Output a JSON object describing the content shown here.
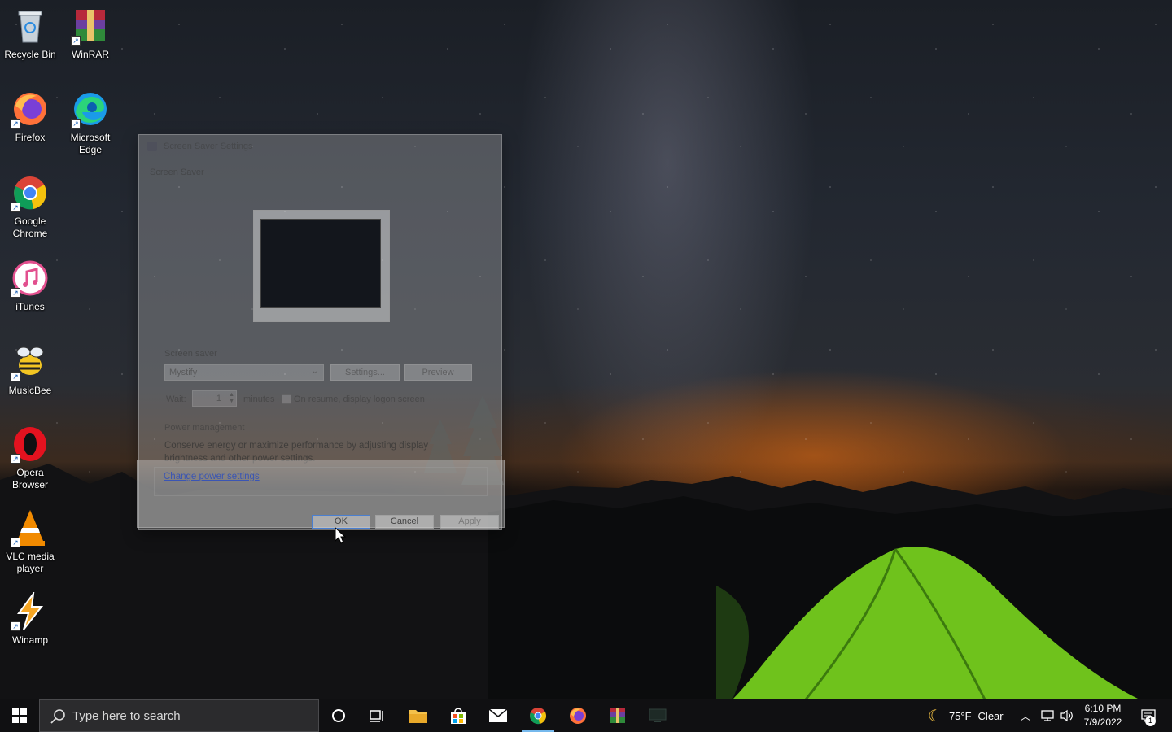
{
  "desktop": {
    "icons": [
      {
        "label": "Recycle Bin",
        "icon": "recycle-bin-icon"
      },
      {
        "label": "WinRAR",
        "icon": "winrar-icon"
      },
      {
        "label": "Firefox",
        "icon": "firefox-icon"
      },
      {
        "label": "Microsoft Edge",
        "icon": "edge-icon"
      },
      {
        "label": "Google Chrome",
        "icon": "chrome-icon"
      },
      {
        "label": "iTunes",
        "icon": "itunes-icon"
      },
      {
        "label": "MusicBee",
        "icon": "musicbee-icon"
      },
      {
        "label": "Opera Browser",
        "icon": "opera-icon"
      },
      {
        "label": "VLC media player",
        "icon": "vlc-icon"
      },
      {
        "label": "Winamp",
        "icon": "winamp-icon"
      }
    ]
  },
  "dialog": {
    "title": "Screen Saver Settings",
    "tab": "Screen Saver",
    "screensaver_label": "Screen saver",
    "screensaver_value": "Mystify",
    "settings_button": "Settings...",
    "preview_button": "Preview",
    "wait_label": "Wait:",
    "wait_value": "1",
    "minutes_label": "minutes",
    "resume_label": "On resume, display logon screen",
    "power_label": "Power management",
    "power_text": "Conserve energy or maximize performance by adjusting display brightness and other power settings.",
    "power_link": "Change power settings",
    "ok_button": "OK",
    "cancel_button": "Cancel",
    "apply_button": "Apply"
  },
  "taskbar": {
    "search_placeholder": "Type here to search",
    "weather_temp": "75°F",
    "weather_cond": "Clear",
    "time": "6:10 PM",
    "date": "7/9/2022",
    "notification_count": "1"
  },
  "colors": {
    "taskbar_bg": "#101012",
    "active_indicator": "#76b9ed",
    "link": "#3a55b4",
    "tent_green": "#7ed321"
  }
}
